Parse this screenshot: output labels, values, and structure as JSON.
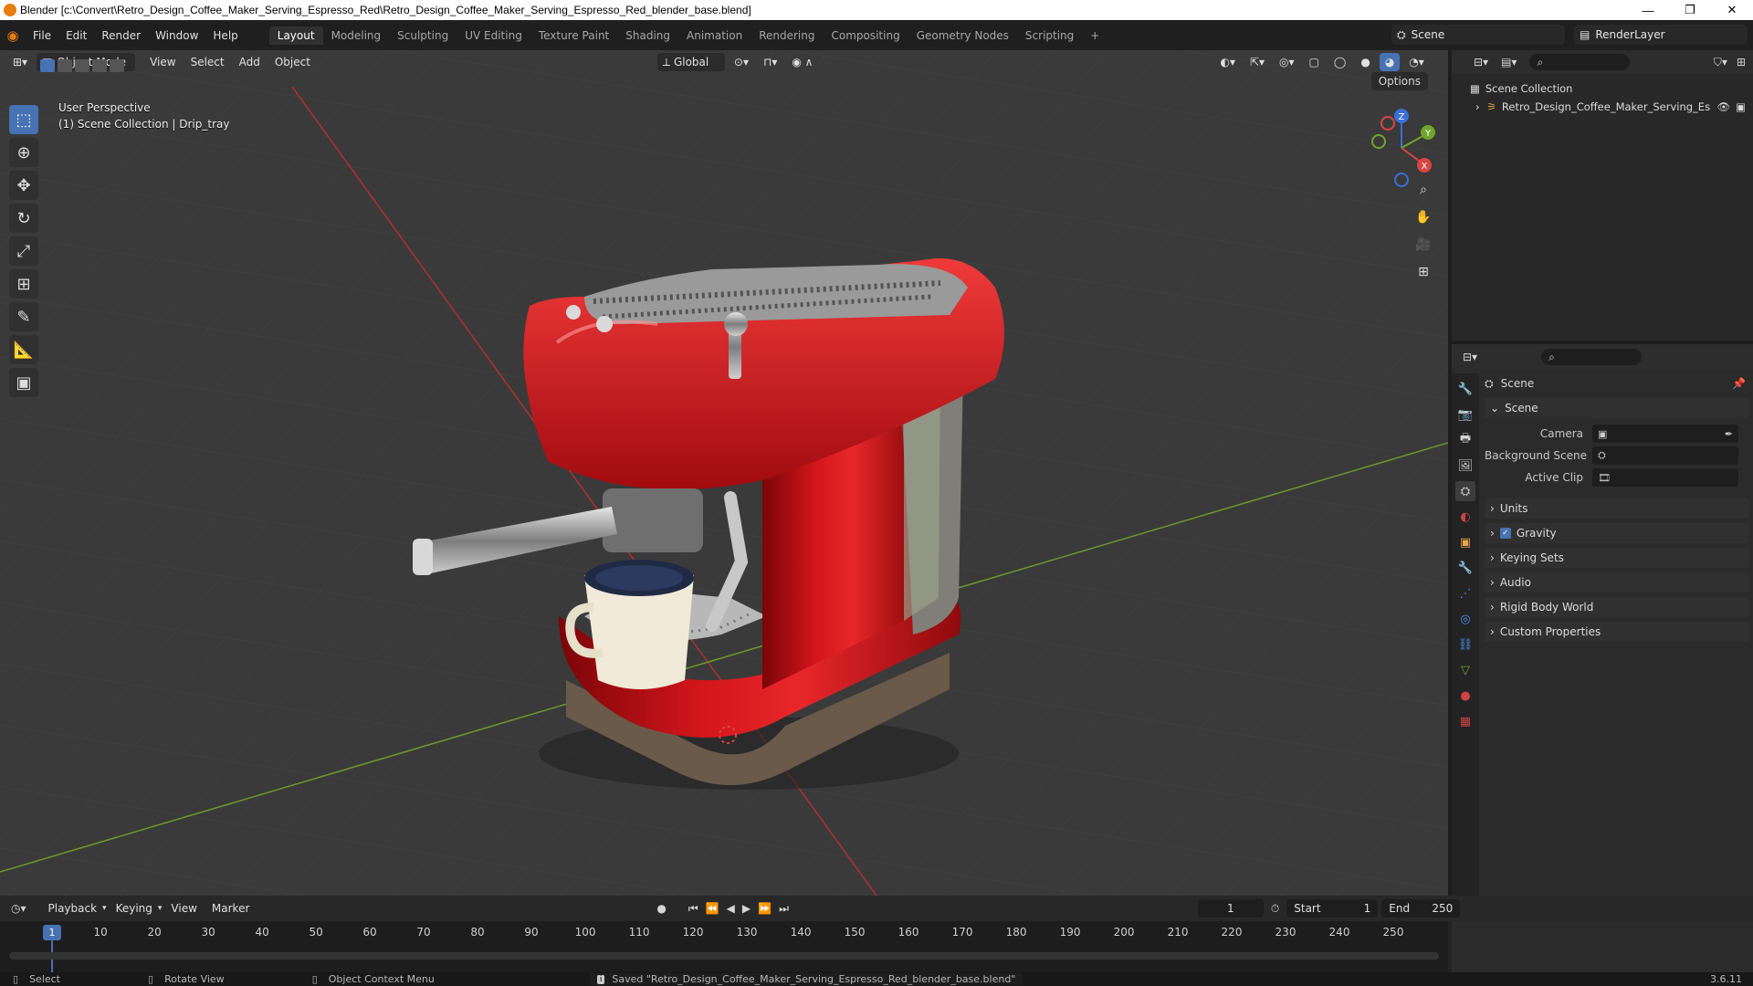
{
  "window": {
    "title": "Blender [c:\\Convert\\Retro_Design_Coffee_Maker_Serving_Espresso_Red\\Retro_Design_Coffee_Maker_Serving_Espresso_Red_blender_base.blend]",
    "min": "—",
    "max": "❐",
    "close": "✕"
  },
  "menu": [
    "File",
    "Edit",
    "Render",
    "Window",
    "Help"
  ],
  "workspaces": [
    "Layout",
    "Modeling",
    "Sculpting",
    "UV Editing",
    "Texture Paint",
    "Shading",
    "Animation",
    "Rendering",
    "Compositing",
    "Geometry Nodes",
    "Scripting"
  ],
  "workspace_add": "+",
  "scene_name": "Scene",
  "view_layer": "RenderLayer",
  "viewport": {
    "mode": "Object Mode",
    "menus": [
      "View",
      "Select",
      "Add",
      "Object"
    ],
    "orientation": "Global",
    "options": "Options",
    "perspective": "User Perspective",
    "collection": "(1) Scene Collection | Drip_tray",
    "gizmo_axes": [
      "X",
      "Y",
      "Z"
    ]
  },
  "outliner": {
    "root": "Scene Collection",
    "child": "Retro_Design_Coffee_Maker_Serving_Es"
  },
  "properties": {
    "header": "Scene",
    "section": "Scene",
    "rows": [
      {
        "label": "Camera",
        "value": ""
      },
      {
        "label": "Background Scene",
        "value": ""
      },
      {
        "label": "Active Clip",
        "value": ""
      }
    ],
    "collapsed": [
      "Units",
      "Gravity",
      "Keying Sets",
      "Audio",
      "Rigid Body World",
      "Custom Properties"
    ]
  },
  "timeline": {
    "menus": [
      "Playback",
      "Keying",
      "View",
      "Marker"
    ],
    "current_frame": "1",
    "start_label": "Start",
    "start": "1",
    "end_label": "End",
    "end": "250",
    "ticks": [
      "1",
      "10",
      "20",
      "30",
      "40",
      "50",
      "60",
      "70",
      "80",
      "90",
      "100",
      "110",
      "120",
      "130",
      "140",
      "150",
      "160",
      "170",
      "180",
      "190",
      "200",
      "210",
      "220",
      "230",
      "240",
      "250"
    ]
  },
  "status": {
    "select": "Select",
    "rotate": "Rotate View",
    "context": "Object Context Menu",
    "saved": "Saved \"Retro_Design_Coffee_Maker_Serving_Espresso_Red_blender_base.blend\"",
    "version": "3.6.11"
  },
  "colors": {
    "accent": "#4772b3",
    "brand": "#e87d0d",
    "body_red": "#c8141a"
  }
}
